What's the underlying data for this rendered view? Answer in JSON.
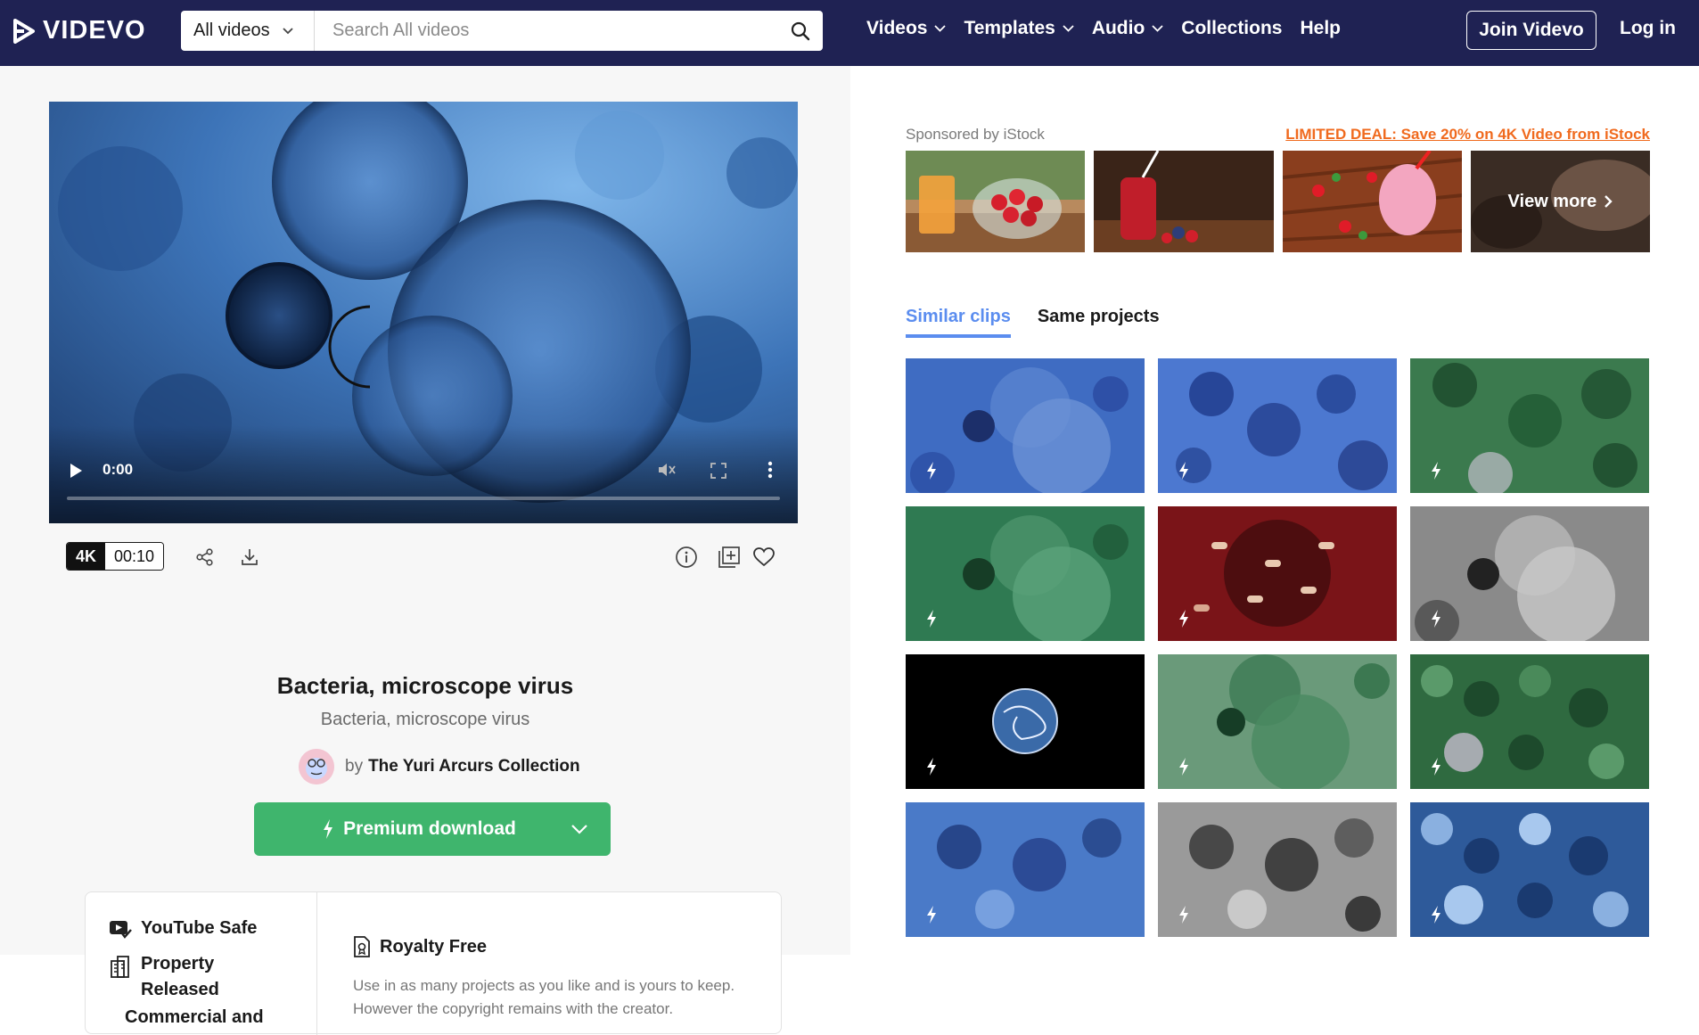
{
  "header": {
    "brand": "VIDEVO",
    "search_category": "All videos",
    "search_placeholder": "Search All videos",
    "nav": {
      "videos": "Videos",
      "templates": "Templates",
      "audio": "Audio",
      "collections": "Collections",
      "help": "Help"
    },
    "join": "Join Videvo",
    "login": "Log in"
  },
  "player": {
    "time": "0:00",
    "progress": 0
  },
  "clip_meta": {
    "resolution": "4K",
    "duration": "00:10"
  },
  "clip": {
    "title": "Bacteria, microscope virus",
    "subtitle": "Bacteria, microscope virus",
    "by": "by",
    "author": "The Yuri Arcurs Collection",
    "download_label": "Premium download"
  },
  "license": {
    "youtube_safe": "YouTube Safe",
    "property_released": "Property Released",
    "commercial": "Commercial and",
    "royalty_free": "Royalty Free",
    "royalty_desc": "Use in as many projects as you like and is yours to keep. However the copyright remains with the creator."
  },
  "sponsored": {
    "label": "Sponsored by iStock",
    "deal": "LIMITED DEAL: Save 20% on 4K Video from iStock",
    "view_more": "View more"
  },
  "tabs": {
    "similar": "Similar clips",
    "same": "Same projects"
  },
  "colors": {
    "header_bg": "#1f2253",
    "accent_blue": "#5b8def",
    "download_green": "#3fb56d",
    "deal_orange": "#f06a1e"
  }
}
